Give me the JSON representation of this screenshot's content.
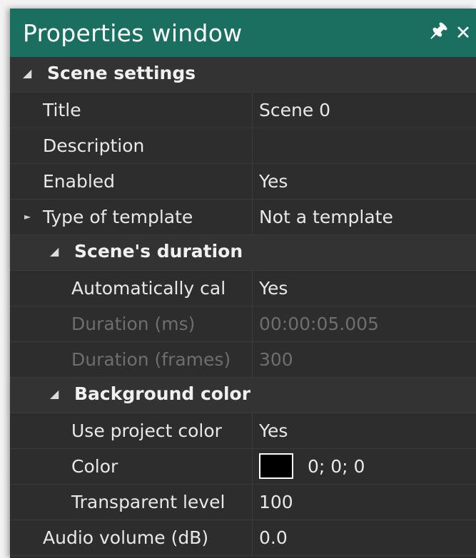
{
  "window": {
    "title": "Properties window",
    "pin_icon": "pin-icon",
    "close_icon": "close-icon",
    "colors": {
      "titlebar": "#1b6f61",
      "background": "#2d2d2d",
      "text": "#e8e8e8",
      "disabled_text": "#6e6e6e"
    }
  },
  "scene_settings": {
    "label": "Scene settings",
    "title": {
      "label": "Title",
      "value": "Scene 0"
    },
    "description": {
      "label": "Description",
      "value": ""
    },
    "enabled": {
      "label": "Enabled",
      "value": "Yes"
    },
    "template_type": {
      "label": "Type of template",
      "value": "Not a template"
    },
    "duration": {
      "label": "Scene's duration",
      "auto_calc": {
        "label": "Automatically cal",
        "value": "Yes"
      },
      "duration_ms": {
        "label": "Duration (ms)",
        "value": "00:00:05.005"
      },
      "duration_frames": {
        "label": "Duration (frames)",
        "value": "300"
      }
    },
    "background": {
      "label": "Background color",
      "use_project_color": {
        "label": "Use project color",
        "value": "Yes"
      },
      "color": {
        "label": "Color",
        "value": "0; 0; 0",
        "swatch": "#000000"
      },
      "transparent_level": {
        "label": "Transparent level",
        "value": "100"
      }
    },
    "audio_volume": {
      "label": "Audio volume (dB)",
      "value": "0.0"
    }
  }
}
